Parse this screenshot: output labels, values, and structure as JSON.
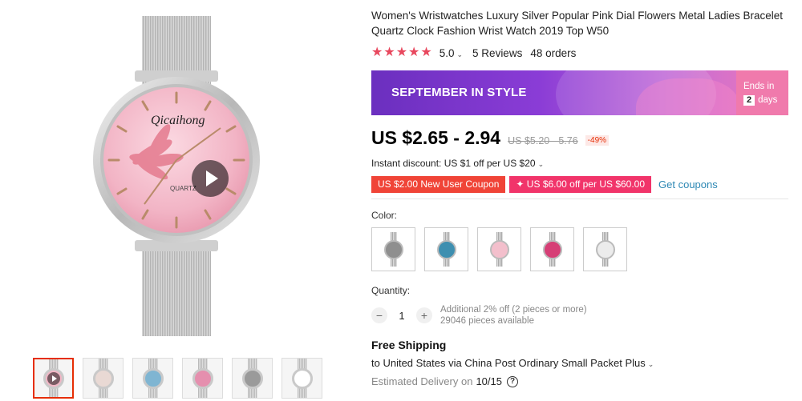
{
  "product": {
    "title": "Women's Wristwatches Luxury Silver Popular Pink Dial Flowers Metal Ladies Bracelet Quartz Clock Fashion Wrist Watch 2019 Top W50",
    "rating": "5.0",
    "rating_stars": 5,
    "reviews": "5 Reviews",
    "orders": "48 orders"
  },
  "gallery": {
    "brand_text": "Qicaihong",
    "dial_text": "QUARTZ",
    "thumbnails": [
      {
        "name": "video-thumbnail",
        "dial": "#f2b7c6"
      },
      {
        "name": "lifestyle-thumbnail",
        "dial": "#e9d9d4"
      },
      {
        "name": "blue-thumbnail",
        "dial": "#7fb5d2"
      },
      {
        "name": "pink-flowers-thumbnail",
        "dial": "#e58fae"
      },
      {
        "name": "gray-thumbnail",
        "dial": "#9a9a9a"
      },
      {
        "name": "size-chart-thumbnail",
        "dial": "#ffffff"
      }
    ]
  },
  "promo": {
    "banner_text": "SEPTEMBER IN STYLE",
    "ends_label": "Ends in",
    "days_num": "2",
    "days_label": "days",
    "colors": {
      "start": "#6b2fbf",
      "end": "#f07ab8"
    }
  },
  "pricing": {
    "price": "US $2.65 - 2.94",
    "original": "US $5.20 - 5.76",
    "discount": "-49%",
    "instant_discount": "Instant discount: US $1 off per US $20",
    "coupon_1": "US $2.00 New User Coupon",
    "coupon_2": "✦ US $6.00 off per US $60.00",
    "get_coupons": "Get coupons"
  },
  "options": {
    "color_label": "Color:",
    "colors": [
      {
        "name": "gray",
        "hex": "#8f8f8f"
      },
      {
        "name": "blue",
        "hex": "#3e8fb0"
      },
      {
        "name": "pink",
        "hex": "#f3bfcc"
      },
      {
        "name": "rose",
        "hex": "#d63f76"
      },
      {
        "name": "white",
        "hex": "#ececec"
      }
    ],
    "quantity_label": "Quantity:",
    "quantity": "1",
    "minus": "−",
    "plus": "+",
    "qty_note_1": "Additional 2% off (2 pieces or more)",
    "qty_note_2": "29046 pieces available"
  },
  "shipping": {
    "title": "Free Shipping",
    "line": "to United States via China Post Ordinary Small Packet Plus",
    "delivery_label": "Estimated Delivery on",
    "delivery_date": "10/15",
    "help": "?"
  },
  "icons": {
    "star": "★",
    "chevron": "⌄"
  }
}
